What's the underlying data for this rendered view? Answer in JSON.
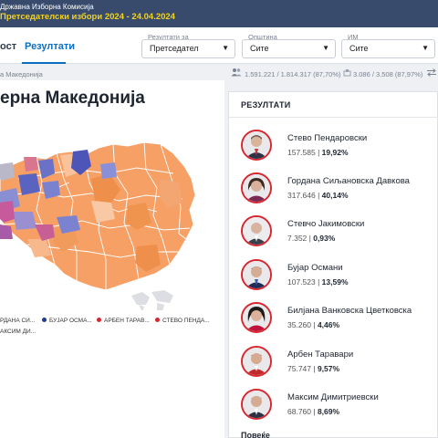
{
  "header": {
    "org": "Државна Изборна Комисија",
    "election": "Претседателски избори 2024 - 24.04.2024"
  },
  "nav": {
    "tab_prev": "ост",
    "tab_results": "Резултати"
  },
  "filters": {
    "results_for": {
      "label": "Резултати за",
      "value": "Претседател"
    },
    "municipality": {
      "label": "Општина",
      "value": "Сите"
    },
    "name": {
      "label": "ИМ",
      "value": "Сите"
    }
  },
  "breadcrumb": "а Македонија",
  "stats": {
    "voters": "1.591.221 / 1.814.317 (87,70%)",
    "stations": "3.086 / 3.508 (87,97%)"
  },
  "map": {
    "title": "ерна Македонија",
    "legend": [
      {
        "label": "РДАНА СИ...",
        "color": "#f0a46b"
      },
      {
        "label": "БУЈАР ОСМА...",
        "color": "#1f3b8c"
      },
      {
        "label": "АРБЕН ТАРАВ...",
        "color": "#d8272f"
      },
      {
        "label": "СТЕВО ПЕНДА...",
        "color": "#d8272f"
      },
      {
        "label": "АКСИМ ДИ...",
        "color": "#999999"
      }
    ]
  },
  "results": {
    "header": "РЕЗУЛТАТИ",
    "candidates": [
      {
        "name": "Стево Пендаровски",
        "votes": "157.585",
        "pct": "19,92%",
        "icon": "avatar-pendarovski"
      },
      {
        "name": "Гордана Сиљановска Давкова",
        "votes": "317.646",
        "pct": "40,14%",
        "icon": "avatar-siljanovska"
      },
      {
        "name": "Стевчо Јакимовски",
        "votes": "7.352",
        "pct": "0,93%",
        "icon": "avatar-jakimovski"
      },
      {
        "name": "Бујар Османи",
        "votes": "107.523",
        "pct": "13,59%",
        "icon": "avatar-osmani"
      },
      {
        "name": "Билјана Ванковска Цветковска",
        "votes": "35.260",
        "pct": "4,46%",
        "icon": "avatar-vankovska"
      },
      {
        "name": "Арбен Таравари",
        "votes": "75.747",
        "pct": "9,57%",
        "icon": "avatar-taravari"
      },
      {
        "name": "Максим Димитриевски",
        "votes": "68.760",
        "pct": "8,69%",
        "icon": "avatar-dimitrievski"
      }
    ],
    "more": "Повеќе"
  }
}
